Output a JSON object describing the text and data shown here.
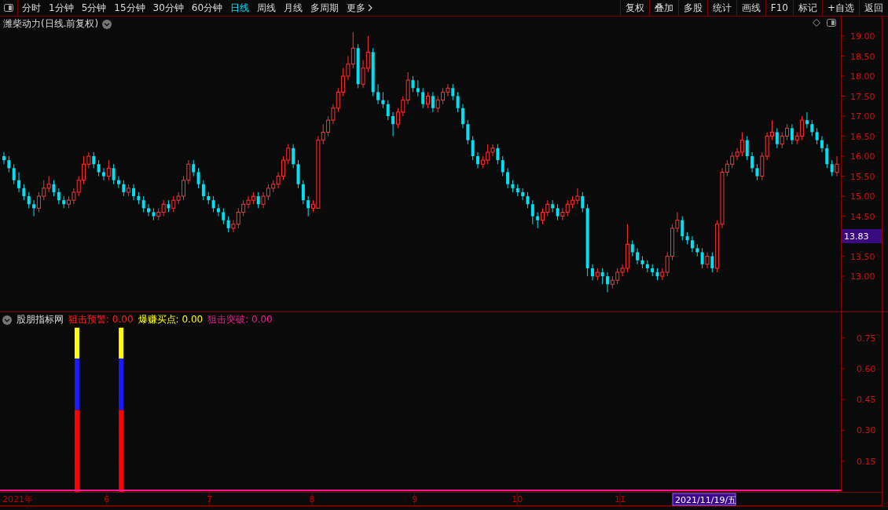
{
  "toolbar": {
    "periods": [
      {
        "label": "分时",
        "selected": false
      },
      {
        "label": "1分钟",
        "selected": false
      },
      {
        "label": "5分钟",
        "selected": false
      },
      {
        "label": "15分钟",
        "selected": false
      },
      {
        "label": "30分钟",
        "selected": false
      },
      {
        "label": "60分钟",
        "selected": false
      },
      {
        "label": "日线",
        "selected": true
      },
      {
        "label": "周线",
        "selected": false
      },
      {
        "label": "月线",
        "selected": false
      },
      {
        "label": "多周期",
        "selected": false
      },
      {
        "label": "更多",
        "selected": false
      }
    ],
    "buttons": [
      "复权",
      "叠加",
      "多股",
      "统计",
      "画线",
      "F10",
      "标记",
      "+自选",
      "返回"
    ]
  },
  "main_chart": {
    "title": "潍柴动力(日线.前复权)",
    "current_price": "13.83",
    "chart_data": {
      "type": "candlestick",
      "ylim": [
        12.12,
        19.49
      ],
      "grid": true,
      "yticks": [
        {
          "value": 19,
          "label": "19.00"
        },
        {
          "value": 18.5,
          "label": "18.50"
        },
        {
          "value": 18,
          "label": "18.00"
        },
        {
          "value": 17.5,
          "label": "17.50"
        },
        {
          "value": 17,
          "label": "17.00"
        },
        {
          "value": 16.5,
          "label": "16.50"
        },
        {
          "value": 16,
          "label": "16.00"
        },
        {
          "value": 15.5,
          "label": "15.50"
        },
        {
          "value": 15,
          "label": "15.00"
        },
        {
          "value": 14.5,
          "label": "14.50"
        },
        {
          "value": 13.5,
          "label": "13.50"
        },
        {
          "value": 13,
          "label": "13.00"
        }
      ],
      "ohlc": [
        [
          16.0,
          16.1,
          15.8,
          15.9
        ],
        [
          15.9,
          16.0,
          15.6,
          15.7
        ],
        [
          15.7,
          15.8,
          15.3,
          15.4
        ],
        [
          15.4,
          15.6,
          15.1,
          15.2
        ],
        [
          15.2,
          15.3,
          14.9,
          15.0
        ],
        [
          15.0,
          15.1,
          14.7,
          14.8
        ],
        [
          14.8,
          14.9,
          14.5,
          14.7
        ],
        [
          14.7,
          15.1,
          14.6,
          15.0
        ],
        [
          15.0,
          15.4,
          14.9,
          15.2
        ],
        [
          15.2,
          15.5,
          15.1,
          15.3
        ],
        [
          15.3,
          15.4,
          15.0,
          15.1
        ],
        [
          15.1,
          15.2,
          14.8,
          14.9
        ],
        [
          14.9,
          15.0,
          14.7,
          14.8
        ],
        [
          14.8,
          15.0,
          14.7,
          14.9
        ],
        [
          14.9,
          15.2,
          14.8,
          15.1
        ],
        [
          15.1,
          15.5,
          15.0,
          15.4
        ],
        [
          15.4,
          16.0,
          15.3,
          15.8
        ],
        [
          15.8,
          16.1,
          15.7,
          16.0
        ],
        [
          16.0,
          16.1,
          15.7,
          15.8
        ],
        [
          15.8,
          15.9,
          15.5,
          15.6
        ],
        [
          15.6,
          15.7,
          15.4,
          15.5
        ],
        [
          15.5,
          15.9,
          15.4,
          15.7
        ],
        [
          15.7,
          15.8,
          15.3,
          15.4
        ],
        [
          15.4,
          15.5,
          15.2,
          15.3
        ],
        [
          15.3,
          15.4,
          15.0,
          15.1
        ],
        [
          15.1,
          15.3,
          15.0,
          15.2
        ],
        [
          15.2,
          15.3,
          14.9,
          15.0
        ],
        [
          15.0,
          15.1,
          14.8,
          14.9
        ],
        [
          14.9,
          15.0,
          14.6,
          14.7
        ],
        [
          14.7,
          14.8,
          14.5,
          14.6
        ],
        [
          14.6,
          14.7,
          14.4,
          14.5
        ],
        [
          14.5,
          14.7,
          14.4,
          14.6
        ],
        [
          14.6,
          14.9,
          14.5,
          14.8
        ],
        [
          14.8,
          14.9,
          14.6,
          14.7
        ],
        [
          14.7,
          15.0,
          14.6,
          14.9
        ],
        [
          14.9,
          15.1,
          14.8,
          15.0
        ],
        [
          15.0,
          15.5,
          14.9,
          15.4
        ],
        [
          15.4,
          15.9,
          15.3,
          15.8
        ],
        [
          15.8,
          15.9,
          15.5,
          15.6
        ],
        [
          15.6,
          15.7,
          15.2,
          15.3
        ],
        [
          15.3,
          15.4,
          14.9,
          15.0
        ],
        [
          15.0,
          15.1,
          14.8,
          14.9
        ],
        [
          14.9,
          15.0,
          14.6,
          14.7
        ],
        [
          14.7,
          14.8,
          14.5,
          14.6
        ],
        [
          14.6,
          14.7,
          14.3,
          14.4
        ],
        [
          14.4,
          14.5,
          14.1,
          14.2
        ],
        [
          14.2,
          14.4,
          14.1,
          14.3
        ],
        [
          14.3,
          14.7,
          14.2,
          14.6
        ],
        [
          14.6,
          14.9,
          14.5,
          14.8
        ],
        [
          14.8,
          15.0,
          14.7,
          14.9
        ],
        [
          14.9,
          15.1,
          14.8,
          15.0
        ],
        [
          15.0,
          15.1,
          14.7,
          14.8
        ],
        [
          14.8,
          15.1,
          14.7,
          15.0
        ],
        [
          15.0,
          15.3,
          14.9,
          15.2
        ],
        [
          15.2,
          15.4,
          15.1,
          15.3
        ],
        [
          15.3,
          15.6,
          15.2,
          15.5
        ],
        [
          15.5,
          16.0,
          15.4,
          15.9
        ],
        [
          15.9,
          16.3,
          15.8,
          16.2
        ],
        [
          16.2,
          16.3,
          15.7,
          15.8
        ],
        [
          15.8,
          15.9,
          15.2,
          15.3
        ],
        [
          15.3,
          15.4,
          14.8,
          14.9
        ],
        [
          14.9,
          15.0,
          14.5,
          14.7
        ],
        [
          14.7,
          14.9,
          14.6,
          14.8
        ],
        [
          14.7,
          16.5,
          14.7,
          16.4
        ],
        [
          16.4,
          16.8,
          16.3,
          16.6
        ],
        [
          16.6,
          17.0,
          16.5,
          16.9
        ],
        [
          16.9,
          17.3,
          16.8,
          17.2
        ],
        [
          17.2,
          17.7,
          17.1,
          17.6
        ],
        [
          17.6,
          18.2,
          17.5,
          18.0
        ],
        [
          18.0,
          18.5,
          17.9,
          18.3
        ],
        [
          18.3,
          19.1,
          18.2,
          18.7
        ],
        [
          18.7,
          18.8,
          17.7,
          17.8
        ],
        [
          17.8,
          18.4,
          17.7,
          18.2
        ],
        [
          18.2,
          19.0,
          18.1,
          18.6
        ],
        [
          18.6,
          18.7,
          17.5,
          17.6
        ],
        [
          17.6,
          17.8,
          17.3,
          17.4
        ],
        [
          17.4,
          17.6,
          17.2,
          17.3
        ],
        [
          17.3,
          17.4,
          16.9,
          17.0
        ],
        [
          17.0,
          17.1,
          16.5,
          16.8
        ],
        [
          16.8,
          17.2,
          16.7,
          17.1
        ],
        [
          17.1,
          17.5,
          17.0,
          17.4
        ],
        [
          17.4,
          18.1,
          17.3,
          17.9
        ],
        [
          17.9,
          18.0,
          17.6,
          17.7
        ],
        [
          17.7,
          17.9,
          17.5,
          17.6
        ],
        [
          17.6,
          17.7,
          17.2,
          17.3
        ],
        [
          17.3,
          17.6,
          17.2,
          17.5
        ],
        [
          17.5,
          17.6,
          17.1,
          17.2
        ],
        [
          17.2,
          17.5,
          17.1,
          17.4
        ],
        [
          17.4,
          17.7,
          17.3,
          17.6
        ],
        [
          17.6,
          17.8,
          17.5,
          17.7
        ],
        [
          17.7,
          17.8,
          17.4,
          17.5
        ],
        [
          17.5,
          17.6,
          17.1,
          17.2
        ],
        [
          17.2,
          17.3,
          16.7,
          16.8
        ],
        [
          16.8,
          16.9,
          16.3,
          16.4
        ],
        [
          16.4,
          16.5,
          15.9,
          16.0
        ],
        [
          16.0,
          16.1,
          15.7,
          15.8
        ],
        [
          15.8,
          16.0,
          15.7,
          15.9
        ],
        [
          15.9,
          16.3,
          15.8,
          16.1
        ],
        [
          16.1,
          16.3,
          16.0,
          16.2
        ],
        [
          16.2,
          16.3,
          15.8,
          15.9
        ],
        [
          15.9,
          16.0,
          15.5,
          15.6
        ],
        [
          15.6,
          15.7,
          15.2,
          15.3
        ],
        [
          15.3,
          15.4,
          15.1,
          15.2
        ],
        [
          15.2,
          15.3,
          15.0,
          15.1
        ],
        [
          15.1,
          15.2,
          14.9,
          15.0
        ],
        [
          15.0,
          15.1,
          14.7,
          14.8
        ],
        [
          14.8,
          14.9,
          14.3,
          14.5
        ],
        [
          14.5,
          14.6,
          14.2,
          14.4
        ],
        [
          14.4,
          14.7,
          14.3,
          14.6
        ],
        [
          14.6,
          14.9,
          14.5,
          14.8
        ],
        [
          14.8,
          14.9,
          14.6,
          14.7
        ],
        [
          14.7,
          14.8,
          14.4,
          14.5
        ],
        [
          14.5,
          14.7,
          14.4,
          14.6
        ],
        [
          14.6,
          14.9,
          14.5,
          14.8
        ],
        [
          14.8,
          15.0,
          14.7,
          14.9
        ],
        [
          14.9,
          15.2,
          14.8,
          15.0
        ],
        [
          15.0,
          15.1,
          14.6,
          14.7
        ],
        [
          14.7,
          14.8,
          13.0,
          13.2
        ],
        [
          13.2,
          13.3,
          12.9,
          13.0
        ],
        [
          13.0,
          13.2,
          12.9,
          13.1
        ],
        [
          13.1,
          13.2,
          12.8,
          13.0
        ],
        [
          13.0,
          13.1,
          12.6,
          12.8
        ],
        [
          12.8,
          13.0,
          12.7,
          12.9
        ],
        [
          12.9,
          13.2,
          12.8,
          13.1
        ],
        [
          13.1,
          13.3,
          13.0,
          13.2
        ],
        [
          13.2,
          14.3,
          13.1,
          13.8
        ],
        [
          13.8,
          13.9,
          13.5,
          13.6
        ],
        [
          13.6,
          13.7,
          13.3,
          13.4
        ],
        [
          13.4,
          13.5,
          13.2,
          13.3
        ],
        [
          13.3,
          13.4,
          13.1,
          13.2
        ],
        [
          13.2,
          13.3,
          13.0,
          13.1
        ],
        [
          13.1,
          13.2,
          12.9,
          13.0
        ],
        [
          13.0,
          13.2,
          12.9,
          13.1
        ],
        [
          13.1,
          13.6,
          13.0,
          13.5
        ],
        [
          13.5,
          14.3,
          13.4,
          14.2
        ],
        [
          14.2,
          14.6,
          14.1,
          14.4
        ],
        [
          14.4,
          14.5,
          13.9,
          14.0
        ],
        [
          14.0,
          14.1,
          13.8,
          13.9
        ],
        [
          13.9,
          14.0,
          13.6,
          13.7
        ],
        [
          13.7,
          13.8,
          13.5,
          13.6
        ],
        [
          13.6,
          13.7,
          13.2,
          13.3
        ],
        [
          13.3,
          13.6,
          13.2,
          13.5
        ],
        [
          13.5,
          13.6,
          13.1,
          13.2
        ],
        [
          13.2,
          14.4,
          13.1,
          14.3
        ],
        [
          14.3,
          15.7,
          14.2,
          15.6
        ],
        [
          15.6,
          15.9,
          15.5,
          15.8
        ],
        [
          15.8,
          16.1,
          15.7,
          16.0
        ],
        [
          16.0,
          16.2,
          15.9,
          16.1
        ],
        [
          16.1,
          16.6,
          16.0,
          16.4
        ],
        [
          16.4,
          16.5,
          15.9,
          16.0
        ],
        [
          16.0,
          16.1,
          15.6,
          15.7
        ],
        [
          15.7,
          15.8,
          15.4,
          15.5
        ],
        [
          15.5,
          16.1,
          15.4,
          16.0
        ],
        [
          16.0,
          16.6,
          15.9,
          16.5
        ],
        [
          16.5,
          16.9,
          16.4,
          16.6
        ],
        [
          16.6,
          16.7,
          16.2,
          16.3
        ],
        [
          16.3,
          16.6,
          16.2,
          16.5
        ],
        [
          16.5,
          16.8,
          16.4,
          16.7
        ],
        [
          16.7,
          16.8,
          16.3,
          16.4
        ],
        [
          16.4,
          16.6,
          16.3,
          16.5
        ],
        [
          16.5,
          17.0,
          16.4,
          16.9
        ],
        [
          16.9,
          17.1,
          16.7,
          16.8
        ],
        [
          16.8,
          16.9,
          16.5,
          16.6
        ],
        [
          16.6,
          16.7,
          16.3,
          16.4
        ],
        [
          16.4,
          16.5,
          16.1,
          16.2
        ],
        [
          16.2,
          16.3,
          15.7,
          15.8
        ],
        [
          15.8,
          15.9,
          15.5,
          15.6
        ],
        [
          15.6,
          16.0,
          15.5,
          15.8
        ]
      ]
    }
  },
  "indicator": {
    "name": "股朋指标网",
    "readings": [
      {
        "label": "狙击预警:",
        "value": "0.00",
        "color": "#ff2020"
      },
      {
        "label": "爆赚买点:",
        "value": "0.00",
        "color": "#ffff00"
      },
      {
        "label": "狙击突破:",
        "value": "0.00",
        "color": "#ff1493"
      }
    ],
    "chart_data": {
      "type": "bar",
      "stacked": true,
      "x": [
        5.71,
        6.14
      ],
      "xlim": [
        4.96,
        13.55
      ],
      "ylim": [
        0,
        0.875
      ],
      "grid": true,
      "xticks": [
        6,
        7,
        8,
        9,
        10,
        11
      ],
      "yticks": [
        {
          "value": 0.75,
          "label": "0.75"
        },
        {
          "value": 0.6,
          "label": "0.60"
        },
        {
          "value": 0.45,
          "label": "0.45"
        },
        {
          "value": 0.3,
          "label": "0.30"
        },
        {
          "value": 0.15,
          "label": "0.15"
        }
      ],
      "series": [
        {
          "color": "#ff0000",
          "values": [
            0.4,
            0.4
          ]
        },
        {
          "color": "#1a1aff",
          "values": [
            0.25,
            0.25
          ]
        },
        {
          "color": "#ffff00",
          "values": [
            0.15,
            0.15
          ]
        }
      ]
    }
  },
  "time_axis": {
    "year_label": "2021年",
    "cursor_date": "2021/11/19/五"
  }
}
